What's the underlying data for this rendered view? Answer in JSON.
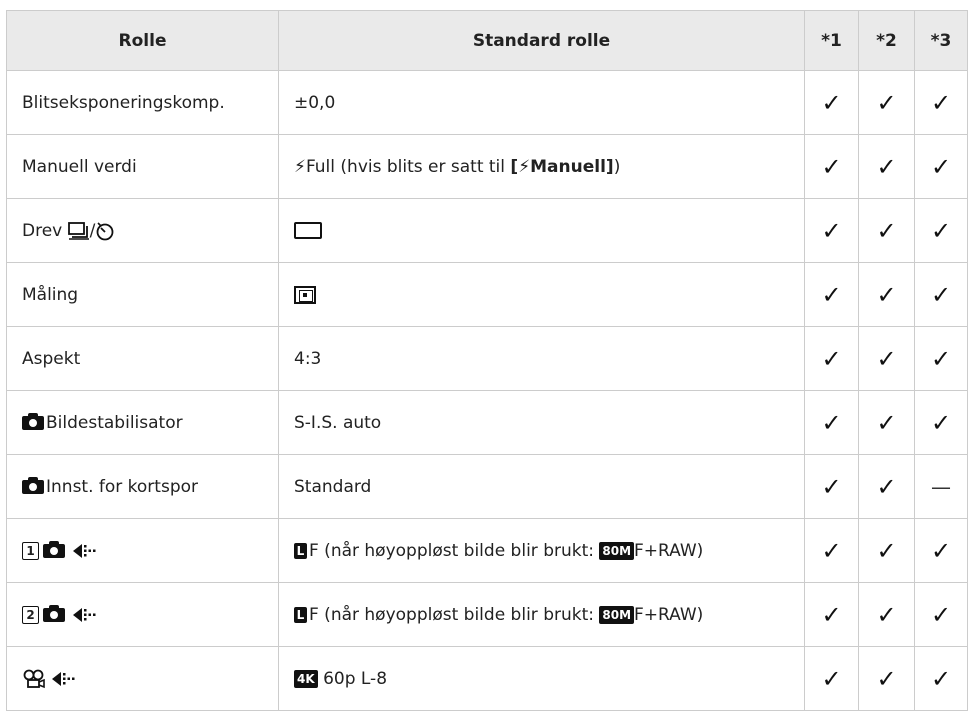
{
  "header": {
    "col1": "Rolle",
    "col2": "Standard rolle",
    "col3": "*1",
    "col4": "*2",
    "col5": "*3"
  },
  "marks": {
    "check": "✓",
    "dash": "—"
  },
  "rows": [
    {
      "role": "Blitseksponeringskomp.",
      "default": "±0,0",
      "c1": "check",
      "c2": "check",
      "c3": "check"
    },
    {
      "role": "Manuell verdi",
      "flash": "⚡",
      "default_a": "Full (hvis blits er satt til ",
      "default_b": "[",
      "default_c": "Manuell]",
      "default_d": ")",
      "c1": "check",
      "c2": "check",
      "c3": "check"
    },
    {
      "role": "Drev",
      "sep": "/",
      "default_icon": "single-frame-icon",
      "c1": "check",
      "c2": "check",
      "c3": "check"
    },
    {
      "role": "Måling",
      "default_icon": "esp-metering-icon",
      "c1": "check",
      "c2": "check",
      "c3": "check"
    },
    {
      "role": "Aspekt",
      "default": "4:3",
      "c1": "check",
      "c2": "check",
      "c3": "check"
    },
    {
      "role": "Bildestabilisator",
      "default": "S-I.S. auto",
      "c1": "check",
      "c2": "check",
      "c3": "check"
    },
    {
      "role": "Innst. for kortspor",
      "default": "Standard",
      "c1": "check",
      "c2": "check",
      "c3": "dash"
    },
    {
      "num": "1",
      "badge": "L",
      "default": "F (når høyoppløst bilde blir brukt: ",
      "badge2": "80M",
      "default_end": "F+RAW)",
      "c1": "check",
      "c2": "check",
      "c3": "check"
    },
    {
      "num": "2",
      "badge": "L",
      "default": "F (når høyoppløst bilde blir brukt: ",
      "badge2": "80M",
      "default_end": "F+RAW)",
      "c1": "check",
      "c2": "check",
      "c3": "check"
    },
    {
      "badge": "4K",
      "default": "60p L-8",
      "c1": "check",
      "c2": "check",
      "c3": "check"
    }
  ],
  "icons": {
    "flash": "flash-icon",
    "camera": "camera-icon",
    "quality": "image-quality-icon",
    "movie": "movie-icon",
    "sequential": "sequential-shooting-icon",
    "selftimer": "self-timer-icon"
  }
}
